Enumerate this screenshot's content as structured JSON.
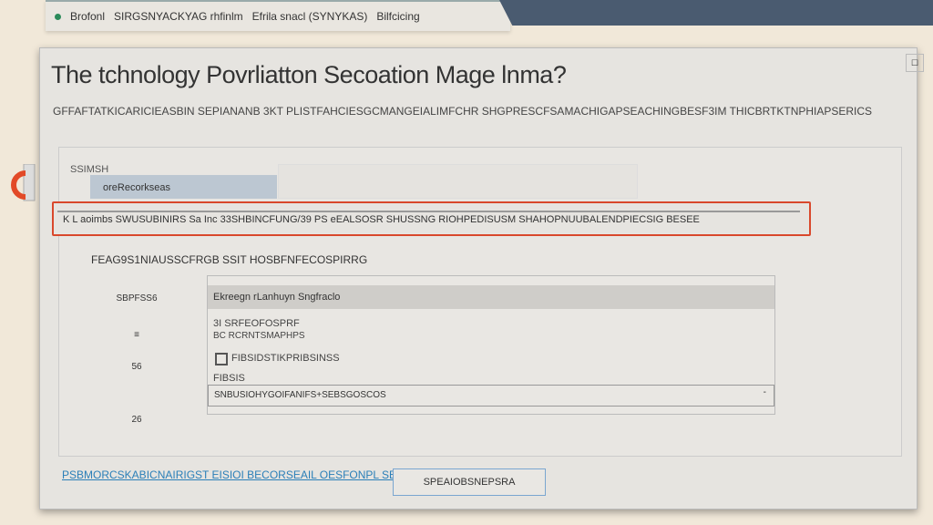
{
  "topbar": {
    "items": [
      "Brofonl",
      "SIRGSNYACKYAG rhfinlm",
      "Efrila snacl (SYNYKAS)",
      "Bilfcicing"
    ]
  },
  "window": {
    "title": "The tchnology Povrliatton Secoation Mage lnma?",
    "subtitle": "GFFAFTATKICARICIEASBIN SEPIANANB 3KT PLISTFAHCIESGCMANGEIALIMFCHR SHGPRESCFSAMACHIGAPSEACHINGBESF3IM THICBRTKTNPHIAPSERICS",
    "close_label": "☐"
  },
  "panel": {
    "section_label": "SSIMSH",
    "nav_item": "oreRecorkseas",
    "selected_row": "K L aoimbs SWUSUBINIRS Sa Inc 33SHBINCFUNG/39 PS eEALSOSR SHUSSNG RIOHPEDISUSM SHAHOPNUUBALENDPIECSIG BESEE",
    "subheading": "FEAG9S1NIAUSSCFRGB SSIT HOSBFNFECOSPIRRG",
    "row_labels": [
      "SBPFSS6",
      "≡",
      "56",
      "26"
    ],
    "grid": {
      "header": "Ekreegn rLanhuyn Sngfraclo",
      "lines": [
        "3I SRFEOFOSPRF",
        "BC RCRNTSMAPHPS"
      ],
      "checkbox_label": "FIBSIDSTIKPRIBSINSS",
      "field_label": "FIBSIS",
      "dropdown_value": "SNBUSIOHYGOIFANIFS+SEBSGOSCOS"
    }
  },
  "footer": {
    "link": "PSBMORCSKABICNAIRIGST EISIOI BECORSEAIL OESFONPL SBBCROEFS IS",
    "button": "SPEAIOBSNEPSRA"
  }
}
